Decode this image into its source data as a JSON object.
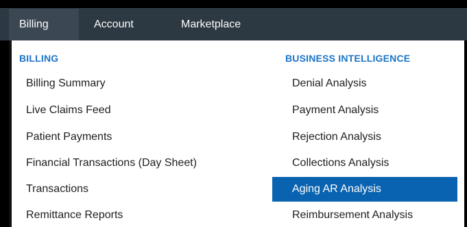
{
  "nav": {
    "items": [
      {
        "label": "Billing"
      },
      {
        "label": "Account"
      },
      {
        "label": "Marketplace"
      }
    ]
  },
  "menu": {
    "billing": {
      "heading": "BILLING",
      "items": [
        {
          "label": "Billing Summary"
        },
        {
          "label": "Live Claims Feed"
        },
        {
          "label": "Patient Payments"
        },
        {
          "label": "Financial Transactions (Day Sheet)"
        },
        {
          "label": "Transactions"
        },
        {
          "label": "Remittance Reports"
        }
      ]
    },
    "business_intelligence": {
      "heading": "BUSINESS INTELLIGENCE",
      "items": [
        {
          "label": "Denial Analysis"
        },
        {
          "label": "Payment Analysis"
        },
        {
          "label": "Rejection Analysis"
        },
        {
          "label": "Collections Analysis"
        },
        {
          "label": "Aging AR Analysis",
          "selected": true
        },
        {
          "label": "Reimbursement Analysis"
        }
      ]
    }
  },
  "colors": {
    "topbar": "#2c3842",
    "heading": "#1a73c6",
    "selected_bg": "#0a63b0"
  }
}
